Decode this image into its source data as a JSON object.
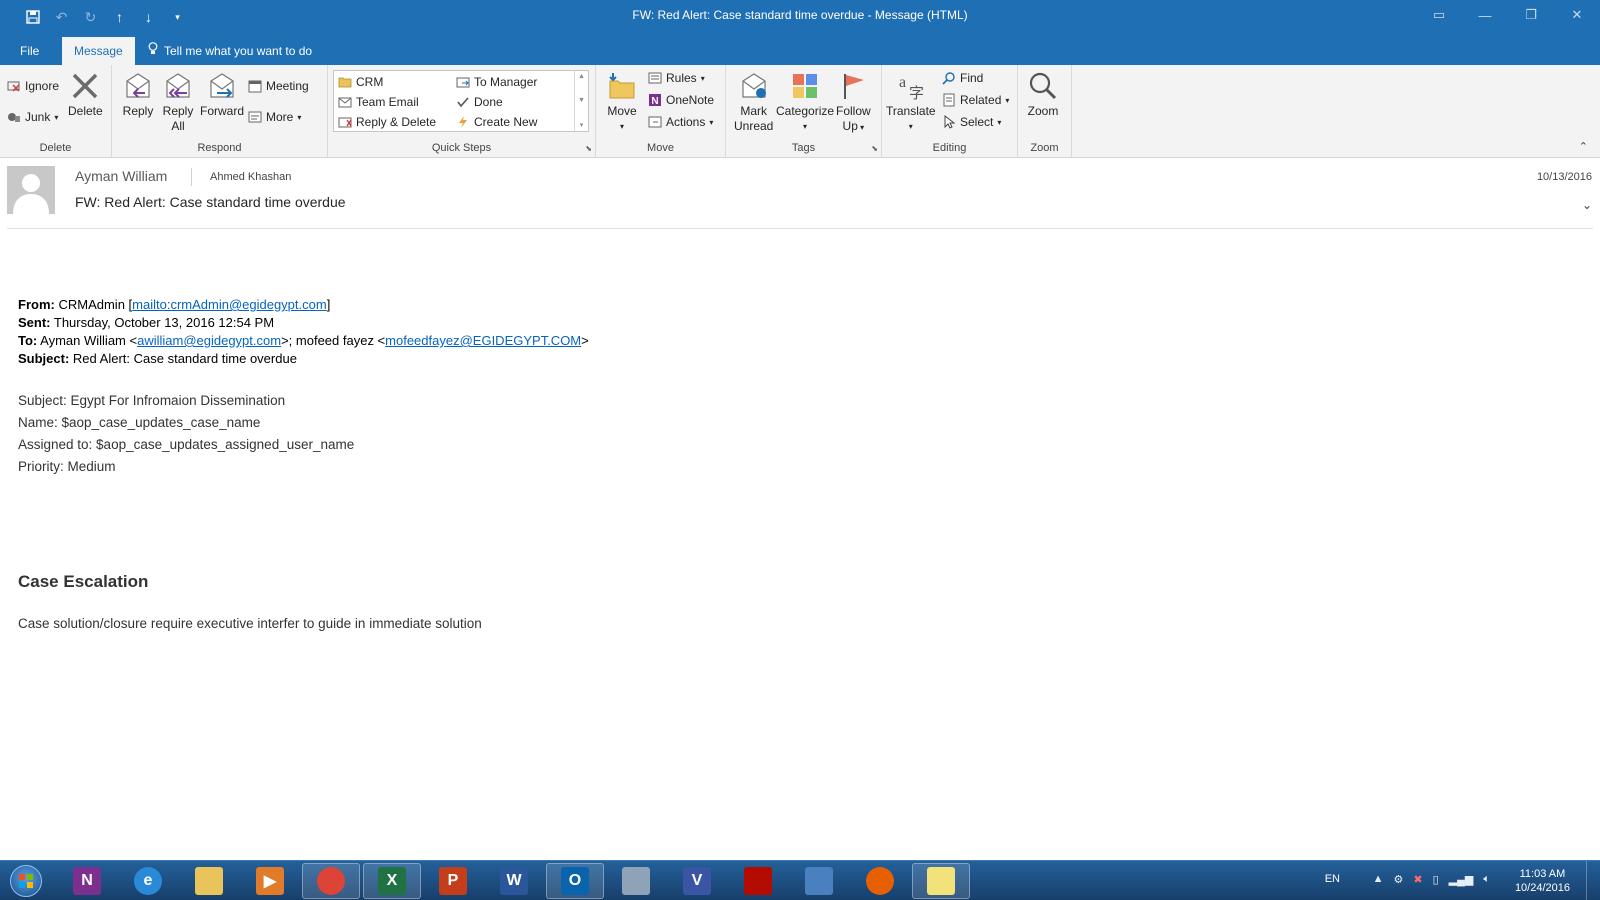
{
  "window": {
    "title": "FW: Red Alert: Case standard time overdue  -  Message (HTML)"
  },
  "tabs": {
    "file": "File",
    "message": "Message",
    "tell_me": "Tell me what you want to do"
  },
  "ribbon": {
    "delete_group": {
      "label": "Delete",
      "ignore": "Ignore",
      "junk": "Junk",
      "delete": "Delete"
    },
    "respond_group": {
      "label": "Respond",
      "reply": "Reply",
      "reply_all_1": "Reply",
      "reply_all_2": "All",
      "forward": "Forward",
      "meeting": "Meeting",
      "more": "More"
    },
    "quick_steps": {
      "label": "Quick Steps",
      "items": [
        "CRM",
        "Team Email",
        "Reply & Delete",
        "To Manager",
        "Done",
        "Create New"
      ]
    },
    "move_group": {
      "label": "Move",
      "move": "Move",
      "rules": "Rules",
      "onenote": "OneNote",
      "actions": "Actions"
    },
    "tags_group": {
      "label": "Tags",
      "mark_unread_1": "Mark",
      "mark_unread_2": "Unread",
      "categorize": "Categorize",
      "follow_up_1": "Follow",
      "follow_up_2": "Up"
    },
    "editing_group": {
      "label": "Editing",
      "translate": "Translate",
      "find": "Find",
      "related": "Related",
      "select": "Select"
    },
    "zoom_group": {
      "label": "Zoom",
      "zoom": "Zoom"
    }
  },
  "message": {
    "sender": "Ayman William",
    "recipient": "Ahmed Khashan",
    "subject": "FW: Red Alert: Case standard time overdue",
    "date": "10/13/2016"
  },
  "body": {
    "from_label": "From:",
    "from_name": "CRMAdmin [",
    "from_link": "mailto:crmAdmin@egidegypt.com",
    "from_end": "]",
    "sent_label": "Sent:",
    "sent_value": "Thursday, October 13, 2016 12:54 PM",
    "to_label": "To:",
    "to_name1": "Ayman William <",
    "to_email1": "awilliam@egidegypt.com",
    "to_mid": ">; mofeed fayez <",
    "to_email2": "mofeedfayez@EGIDEGYPT.COM",
    "to_end": ">",
    "subject_label": "Subject:",
    "subject_value": "Red Alert: Case standard time overdue",
    "details": [
      "Subject: Egypt For Infromaion Dissemination",
      "Name: $aop_case_updates_case_name",
      "Assigned to: $aop_case_updates_assigned_user_name",
      "Priority: Medium"
    ],
    "escalation_title": "Case Escalation",
    "escalation_text": "Case solution/closure require executive interfer to guide in immediate solution"
  },
  "taskbar": {
    "apps": [
      {
        "name": "onenote",
        "letter": "N",
        "color": "#7d2f8f"
      },
      {
        "name": "internet-explorer",
        "letter": "e",
        "color": "#2a8ad8"
      },
      {
        "name": "file-explorer",
        "letter": "",
        "color": "#e8c45a"
      },
      {
        "name": "media-player",
        "letter": "▶",
        "color": "#e07b2a"
      },
      {
        "name": "chrome",
        "letter": "",
        "color": "#db4437"
      },
      {
        "name": "excel",
        "letter": "X",
        "color": "#207245"
      },
      {
        "name": "powerpoint",
        "letter": "P",
        "color": "#c43e1c"
      },
      {
        "name": "word",
        "letter": "W",
        "color": "#2b579a"
      },
      {
        "name": "outlook",
        "letter": "O",
        "color": "#0a64ad"
      },
      {
        "name": "calculator",
        "letter": "",
        "color": "#8fa3b8"
      },
      {
        "name": "visio",
        "letter": "V",
        "color": "#3955a3"
      },
      {
        "name": "acrobat",
        "letter": "",
        "color": "#b30b00"
      },
      {
        "name": "remote-desktop",
        "letter": "",
        "color": "#4a7fc0"
      },
      {
        "name": "firefox",
        "letter": "",
        "color": "#e66000"
      },
      {
        "name": "sticky-notes",
        "letter": "",
        "color": "#f1e27a"
      }
    ],
    "language": "EN",
    "time": "11:03 AM",
    "date": "10/24/2016"
  },
  "colors": {
    "brand": "#1f6fb5",
    "link": "#0563c1"
  }
}
